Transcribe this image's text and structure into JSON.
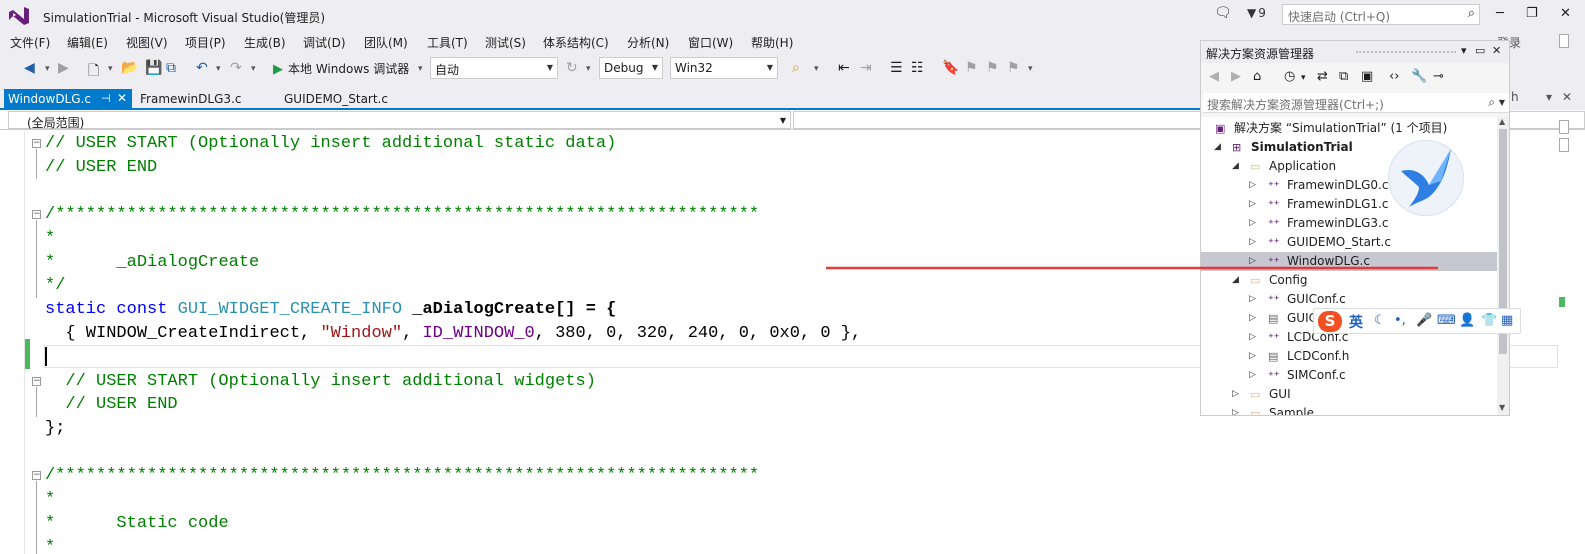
{
  "window": {
    "title": "SimulationTrial - Microsoft Visual Studio(管理员)",
    "notifications_count": "9",
    "quick_launch_placeholder": "快速启动 (Ctrl+Q)",
    "login_label": "登录",
    "minimize": "─",
    "maximize": "❐",
    "close": "✕"
  },
  "menu": {
    "items": [
      "文件(F)",
      "编辑(E)",
      "视图(V)",
      "项目(P)",
      "生成(B)",
      "调试(D)",
      "团队(M)",
      "工具(T)",
      "测试(S)",
      "体系结构(C)",
      "分析(N)",
      "窗口(W)",
      "帮助(H)"
    ]
  },
  "toolbar": {
    "run_label": "本地 Windows 调试器",
    "solution_config": "自动",
    "configuration": "Debug",
    "platform": "Win32"
  },
  "tabs": [
    {
      "label": "WindowDLG.c",
      "active": true,
      "pinned": true
    },
    {
      "label": "FramewinDLG3.c",
      "active": false
    },
    {
      "label": "GUIDEMO_Start.c",
      "active": false
    }
  ],
  "navigation": {
    "scope": "(全局范围)"
  },
  "editor": {
    "lines": {
      "l1": "// USER START (Optionally insert additional static data)",
      "l2": "// USER END",
      "l3": "/*********************************************************************",
      "l4": "*",
      "l5_star": "*",
      "l5_name": "_aDialogCreate",
      "l6": "*/",
      "l7_static": "static",
      "l7_const": "const",
      "l7_type": "GUI_WIDGET_CREATE_INFO",
      "l7_name": "_aDialogCreate[] = {",
      "l8_a": "{ WINDOW_CreateIndirect, ",
      "l8_str": "\"Window\"",
      "l8_b": ", ",
      "l8_macro": "ID_WINDOW_0",
      "l8_c": ", 380, 0, 320, 240, 0, 0x0, 0 },",
      "l10": "// USER START (Optionally insert additional widgets)",
      "l11": "// USER END",
      "l12": "};",
      "l13": "/*********************************************************************",
      "l14": "*",
      "l15_star": "*",
      "l15_name": "Static code",
      "l16": "*"
    }
  },
  "solution_explorer": {
    "title": "解决方案资源管理器",
    "search_placeholder": "搜索解决方案资源管理器(Ctrl+;)",
    "solution_label": "解决方案 “SimulationTrial” (1 个项目)",
    "project": "SimulationTrial",
    "folders": {
      "application": "Application",
      "config": "Config",
      "gui": "GUI",
      "sample": "Sample"
    },
    "application_files": [
      "FramewinDLG0.c",
      "FramewinDLG1.c",
      "FramewinDLG3.c",
      "GUIDEMO_Start.c",
      "WindowDLG.c"
    ],
    "config_files": [
      "GUIConf.c",
      "GUIConf.h",
      "LCDConf.c",
      "LCDConf.h",
      "SIMConf.c"
    ]
  },
  "ime": {
    "logo": "S",
    "language": "英"
  },
  "right_panel": {
    "tab_fragment": "h"
  },
  "colors": {
    "accent": "#007acc",
    "comment": "#008000",
    "keyword": "#0000ff",
    "type": "#2b91af",
    "string": "#a31515",
    "macro": "#6f008a",
    "annotation": "#e53935"
  }
}
